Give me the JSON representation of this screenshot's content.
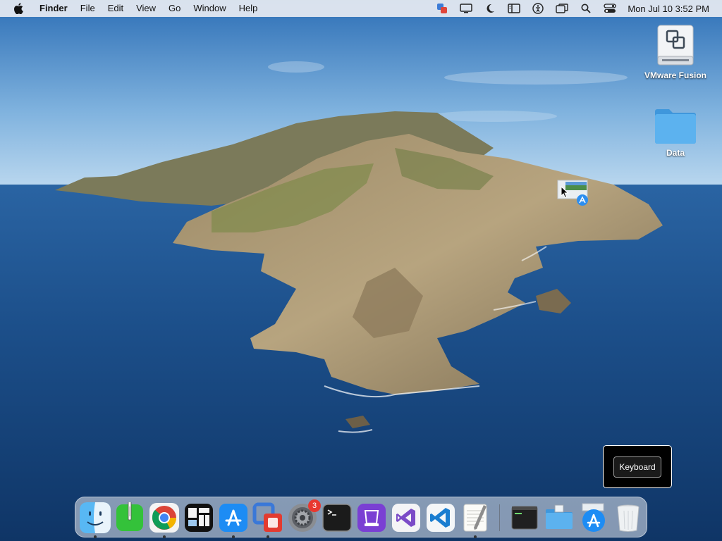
{
  "menubar": {
    "app_name": "Finder",
    "menus": [
      "File",
      "Edit",
      "View",
      "Go",
      "Window",
      "Help"
    ],
    "status_icons": [
      "vmware-status-icon",
      "display-icon",
      "moon-icon",
      "sidebar-icon",
      "accessibility-icon",
      "screen-mirror-icon",
      "search-icon",
      "control-center-icon"
    ],
    "clock": "Mon Jul 10  3:52 PM"
  },
  "desktop": {
    "icons": [
      {
        "label": "VMware Fusion",
        "icon": "disk-icon"
      },
      {
        "label": "Data",
        "icon": "folder-icon"
      }
    ]
  },
  "hud": {
    "button_label": "Keyboard"
  },
  "dock": {
    "apps": [
      {
        "name": "Finder",
        "running": true
      },
      {
        "name": "Script Editor",
        "running": false
      },
      {
        "name": "Google Chrome",
        "running": true
      },
      {
        "name": "Activity Board",
        "running": false
      },
      {
        "name": "App Store",
        "running": true
      },
      {
        "name": "VMware Fusion",
        "running": true
      },
      {
        "name": "System Preferences",
        "running": false,
        "badge": "3"
      },
      {
        "name": "Terminal",
        "running": false
      },
      {
        "name": "Simulator",
        "running": false
      },
      {
        "name": "Visual Studio",
        "running": false
      },
      {
        "name": "Visual Studio Code",
        "running": false
      },
      {
        "name": "TextEdit",
        "running": true
      }
    ],
    "right_items": [
      "Console",
      "Downloads",
      "App Store Folder",
      "Trash"
    ]
  },
  "colors": {
    "sky_top": "#2f6fb5",
    "sea": "#1d4f86",
    "menubar": "#e8ecf2",
    "badge": "#e8382f",
    "folder": "#5cb2ef"
  }
}
